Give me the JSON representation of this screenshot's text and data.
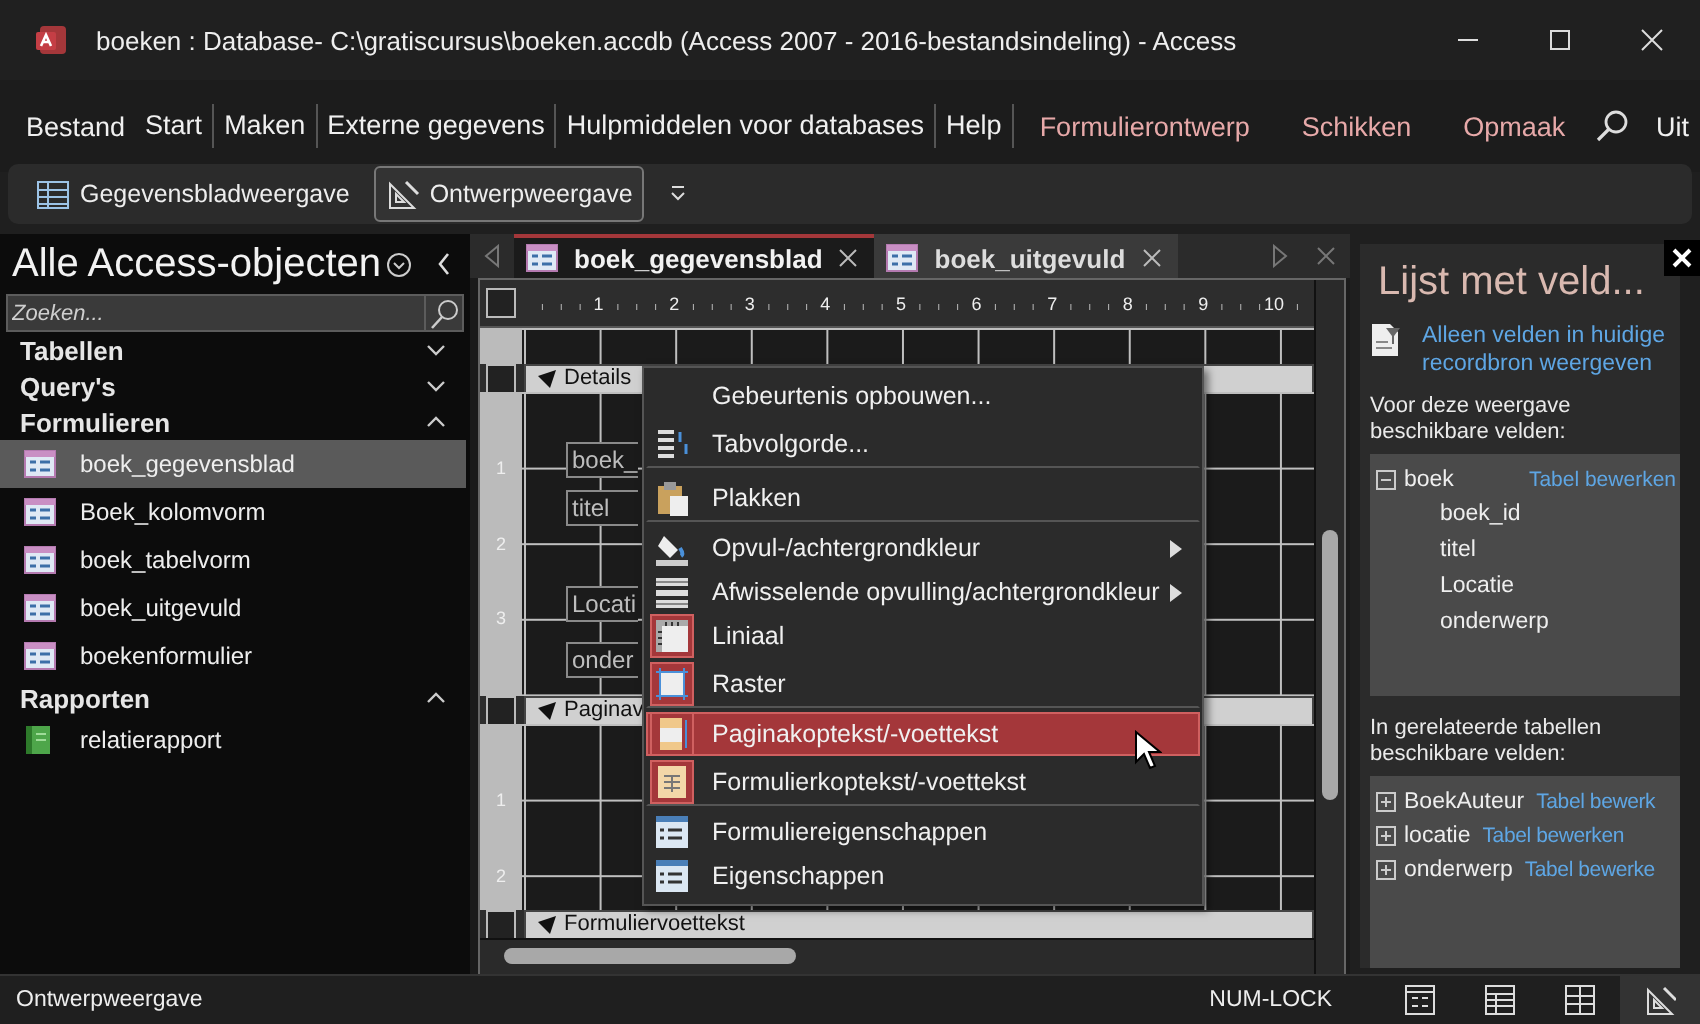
{
  "window": {
    "title": "boeken : Database- C:\\gratiscursus\\boeken.accdb (Access 2007 - 2016-bestandsindeling)  -  Access"
  },
  "ribbon_tabs": [
    {
      "label": "Bestand",
      "kind": "normal",
      "separator_after": false
    },
    {
      "label": "Start",
      "kind": "normal",
      "separator_after": true
    },
    {
      "label": "Maken",
      "kind": "normal",
      "separator_after": true
    },
    {
      "label": "Externe gegevens",
      "kind": "normal",
      "separator_after": true
    },
    {
      "label": "Hulpmiddelen voor databases",
      "kind": "normal",
      "separator_after": true
    },
    {
      "label": "Help",
      "kind": "normal",
      "separator_after": true
    },
    {
      "label": "Formulierontwerp",
      "kind": "contextual",
      "separator_after": false
    },
    {
      "label": "Schikken",
      "kind": "contextual",
      "separator_after": false
    },
    {
      "label": "Opmaak",
      "kind": "contextual",
      "separator_after": false
    }
  ],
  "ribbon_overflow": {
    "label": "Uit"
  },
  "view_buttons": [
    {
      "label": "Gegevensbladweergave",
      "selected": false
    },
    {
      "label": "Ontwerpweergave",
      "selected": true
    }
  ],
  "navigation": {
    "title": "Alle Access-objecten",
    "search": {
      "placeholder": "Zoeken..."
    },
    "groups": [
      {
        "label": "Tabellen",
        "expanded": false
      },
      {
        "label": "Query's",
        "expanded": false
      },
      {
        "label": "Formulieren",
        "expanded": true,
        "children": [
          {
            "label": "boek_gegevensblad",
            "kind": "form",
            "selected": true
          },
          {
            "label": "Boek_kolomvorm",
            "kind": "form",
            "selected": false
          },
          {
            "label": "boek_tabelvorm",
            "kind": "form",
            "selected": false
          },
          {
            "label": "boek_uitgevuld",
            "kind": "form",
            "selected": false
          },
          {
            "label": "boekenformulier",
            "kind": "form",
            "selected": false
          }
        ]
      },
      {
        "label": "Rapporten",
        "expanded": true,
        "children": [
          {
            "label": "relatierapport",
            "kind": "report",
            "selected": false
          }
        ]
      }
    ]
  },
  "document_tabs": [
    {
      "label": "boek_gegevensblad",
      "selected": true
    },
    {
      "label": "boek_uitgevuld",
      "selected": false
    }
  ],
  "form_design": {
    "ruler": [
      "1",
      "2",
      "3",
      "4",
      "5",
      "6",
      "7",
      "8",
      "9",
      "10"
    ],
    "sections": [
      {
        "label": "Details",
        "ruler_marks": [
          "1",
          "2",
          "3"
        ],
        "controls": [
          "boek_",
          "titel",
          "Locati",
          "onder"
        ]
      },
      {
        "label": "Paginav",
        "ruler_marks": [
          "1",
          "2"
        ]
      },
      {
        "label": "Formuliervoettekst"
      }
    ]
  },
  "context_menu": {
    "items": [
      {
        "label": "Gebeurtenis opbouwen...",
        "checked": false,
        "submenu": false,
        "selected": false,
        "separator_after": false
      },
      {
        "label": "Tabvolgorde...",
        "checked": false,
        "submenu": false,
        "selected": false,
        "separator_after": true
      },
      {
        "label": "Plakken",
        "checked": false,
        "submenu": false,
        "selected": false,
        "separator_after": true
      },
      {
        "label": "Opvul-/achtergrondkleur",
        "checked": false,
        "submenu": true,
        "selected": false,
        "separator_after": false
      },
      {
        "label": "Afwisselende opvulling/achtergrondkleur",
        "checked": false,
        "submenu": true,
        "selected": false,
        "separator_after": false
      },
      {
        "label": "Liniaal",
        "checked": true,
        "submenu": false,
        "selected": false,
        "separator_after": false
      },
      {
        "label": "Raster",
        "checked": true,
        "submenu": false,
        "selected": false,
        "separator_after": true
      },
      {
        "label": "Paginakoptekst/-voettekst",
        "checked": true,
        "submenu": false,
        "selected": true,
        "separator_after": false
      },
      {
        "label": "Formulierkoptekst/-voettekst",
        "checked": true,
        "submenu": false,
        "selected": false,
        "separator_after": true
      },
      {
        "label": "Formuliereigenschappen",
        "checked": false,
        "submenu": false,
        "selected": false,
        "separator_after": false
      },
      {
        "label": "Eigenschappen",
        "checked": false,
        "submenu": false,
        "selected": false,
        "separator_after": false
      }
    ]
  },
  "field_list": {
    "title": "Lijst met veld...",
    "link": "Alleen velden in huidige recordbron weergeven",
    "current_heading": "Voor deze weergave beschikbare velden:",
    "current_tables": [
      {
        "name": "boek",
        "expanded": true,
        "edit_link": "Tabel bewerken",
        "fields": [
          "boek_id",
          "titel",
          "Locatie",
          "onderwerp"
        ]
      }
    ],
    "related_heading": "In gerelateerde tabellen beschikbare velden:",
    "related_tables": [
      {
        "name": "BoekAuteur",
        "expanded": false,
        "edit_link": "Tabel bewerk"
      },
      {
        "name": "locatie",
        "expanded": false,
        "edit_link": "Tabel bewerken"
      },
      {
        "name": "onderwerp",
        "expanded": false,
        "edit_link": "Tabel bewerke"
      }
    ]
  },
  "status_bar": {
    "text": "Ontwerpweergave",
    "indicator": "NUM-LOCK",
    "views": [
      {
        "selected": false
      },
      {
        "selected": false
      },
      {
        "selected": false
      },
      {
        "selected": true
      }
    ]
  }
}
